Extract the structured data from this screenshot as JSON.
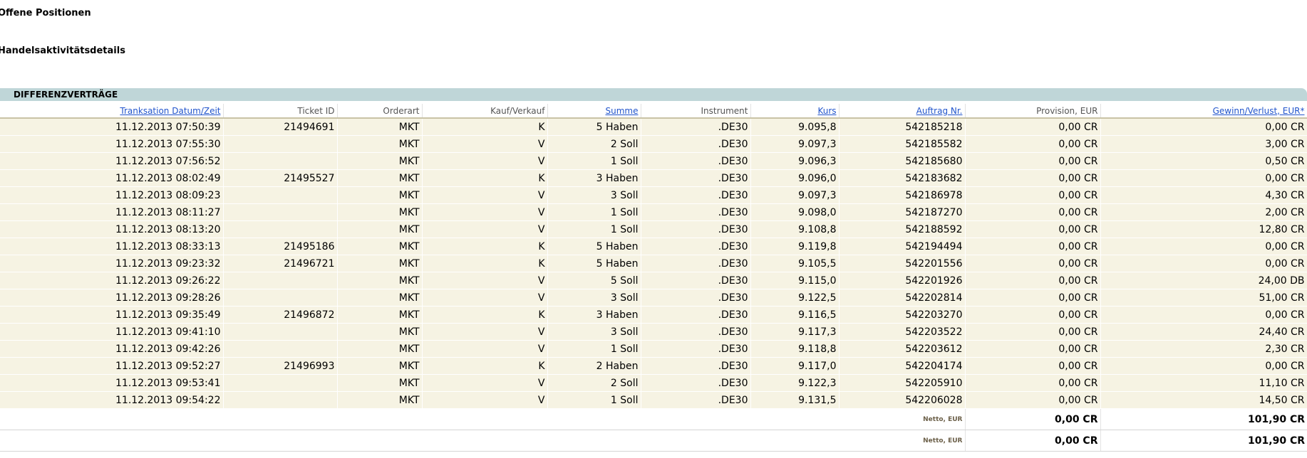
{
  "headings": {
    "open_positions": "Offene Positionen",
    "trade_activity": "Handelsaktivitätsdetails"
  },
  "section": {
    "title": "DIFFERENZVERTRÄGE"
  },
  "columns": [
    {
      "key": "datetime",
      "label": "Tranksation Datum/Zeit",
      "link": true
    },
    {
      "key": "ticket",
      "label": "Ticket ID",
      "link": false
    },
    {
      "key": "ordertype",
      "label": "Orderart",
      "link": false
    },
    {
      "key": "buysell",
      "label": "Kauf/Verkauf",
      "link": false
    },
    {
      "key": "amount",
      "label": "Summe",
      "link": true
    },
    {
      "key": "instrument",
      "label": "Instrument",
      "link": false
    },
    {
      "key": "price",
      "label": "Kurs",
      "link": true
    },
    {
      "key": "order",
      "label": "Auftrag Nr.",
      "link": true
    },
    {
      "key": "commission",
      "label": "Provision, EUR",
      "link": false
    },
    {
      "key": "pnl",
      "label": "Gewinn/Verlust, EUR*",
      "link": true
    }
  ],
  "rows": [
    [
      "11.12.2013 07:50:39",
      "21494691",
      "MKT",
      "K",
      "5 Haben",
      ".DE30",
      "9.095,8",
      "542185218",
      "0,00 CR",
      "0,00 CR"
    ],
    [
      "11.12.2013 07:55:30",
      "",
      "MKT",
      "V",
      "2 Soll",
      ".DE30",
      "9.097,3",
      "542185582",
      "0,00 CR",
      "3,00 CR"
    ],
    [
      "11.12.2013 07:56:52",
      "",
      "MKT",
      "V",
      "1 Soll",
      ".DE30",
      "9.096,3",
      "542185680",
      "0,00 CR",
      "0,50 CR"
    ],
    [
      "11.12.2013 08:02:49",
      "21495527",
      "MKT",
      "K",
      "3 Haben",
      ".DE30",
      "9.096,0",
      "542183682",
      "0,00 CR",
      "0,00 CR"
    ],
    [
      "11.12.2013 08:09:23",
      "",
      "MKT",
      "V",
      "3 Soll",
      ".DE30",
      "9.097,3",
      "542186978",
      "0,00 CR",
      "4,30 CR"
    ],
    [
      "11.12.2013 08:11:27",
      "",
      "MKT",
      "V",
      "1 Soll",
      ".DE30",
      "9.098,0",
      "542187270",
      "0,00 CR",
      "2,00 CR"
    ],
    [
      "11.12.2013 08:13:20",
      "",
      "MKT",
      "V",
      "1 Soll",
      ".DE30",
      "9.108,8",
      "542188592",
      "0,00 CR",
      "12,80 CR"
    ],
    [
      "11.12.2013 08:33:13",
      "21495186",
      "MKT",
      "K",
      "5 Haben",
      ".DE30",
      "9.119,8",
      "542194494",
      "0,00 CR",
      "0,00 CR"
    ],
    [
      "11.12.2013 09:23:32",
      "21496721",
      "MKT",
      "K",
      "5 Haben",
      ".DE30",
      "9.105,5",
      "542201556",
      "0,00 CR",
      "0,00 CR"
    ],
    [
      "11.12.2013 09:26:22",
      "",
      "MKT",
      "V",
      "5 Soll",
      ".DE30",
      "9.115,0",
      "542201926",
      "0,00 CR",
      "24,00 DB"
    ],
    [
      "11.12.2013 09:28:26",
      "",
      "MKT",
      "V",
      "3 Soll",
      ".DE30",
      "9.122,5",
      "542202814",
      "0,00 CR",
      "51,00 CR"
    ],
    [
      "11.12.2013 09:35:49",
      "21496872",
      "MKT",
      "K",
      "3 Haben",
      ".DE30",
      "9.116,5",
      "542203270",
      "0,00 CR",
      "0,00 CR"
    ],
    [
      "11.12.2013 09:41:10",
      "",
      "MKT",
      "V",
      "3 Soll",
      ".DE30",
      "9.117,3",
      "542203522",
      "0,00 CR",
      "24,40 CR"
    ],
    [
      "11.12.2013 09:42:26",
      "",
      "MKT",
      "V",
      "1 Soll",
      ".DE30",
      "9.118,8",
      "542203612",
      "0,00 CR",
      "2,30 CR"
    ],
    [
      "11.12.2013 09:52:27",
      "21496993",
      "MKT",
      "K",
      "2 Haben",
      ".DE30",
      "9.117,0",
      "542204174",
      "0,00 CR",
      "0,00 CR"
    ],
    [
      "11.12.2013 09:53:41",
      "",
      "MKT",
      "V",
      "2 Soll",
      ".DE30",
      "9.122,3",
      "542205910",
      "0,00 CR",
      "11,10 CR"
    ],
    [
      "11.12.2013 09:54:22",
      "",
      "MKT",
      "V",
      "1 Soll",
      ".DE30",
      "9.131,5",
      "542206028",
      "0,00 CR",
      "14,50 CR"
    ]
  ],
  "totals": [
    {
      "label": "Netto, EUR",
      "commission": "0,00 CR",
      "pnl": "101,90 CR"
    },
    {
      "label": "Netto, EUR",
      "commission": "0,00 CR",
      "pnl": "101,90 CR"
    }
  ],
  "colors": {
    "row_background": "#f6f3e3",
    "section_bar": "#bfd6d8",
    "link": "#2255cc",
    "header_underline": "#c9c3a6"
  }
}
